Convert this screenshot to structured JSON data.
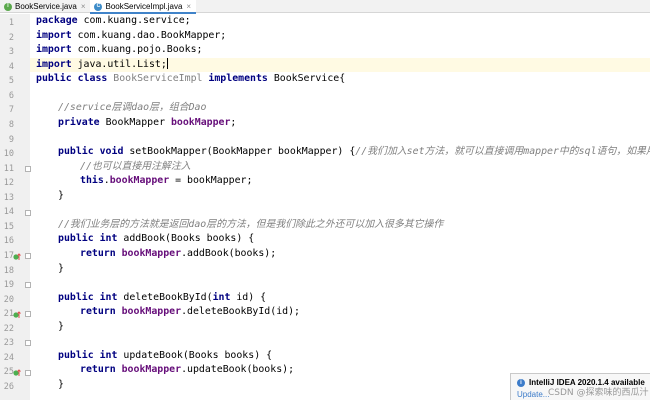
{
  "tabs": [
    {
      "label": "BookService.java",
      "kind": "interface",
      "icon": "interface-icon",
      "active": false
    },
    {
      "label": "BookServiceImpl.java",
      "kind": "class",
      "icon": "class-icon",
      "active": true
    }
  ],
  "close_glyph": "×",
  "line_numbers": [
    "1",
    "2",
    "3",
    "4",
    "5",
    "6",
    "7",
    "8",
    "9",
    "10",
    "11",
    "12",
    "13",
    "14",
    "15",
    "16",
    "17",
    "18",
    "19",
    "20",
    "21",
    "22",
    "23",
    "24",
    "25",
    "26"
  ],
  "code": {
    "l1": {
      "kw": "package",
      "rest": " com.kuang.service;"
    },
    "l2": {
      "kw": "import",
      "rest": " com.kuang.dao.BookMapper;"
    },
    "l3": {
      "kw": "import",
      "rest": " com.kuang.pojo.Books;"
    },
    "l4": {
      "kw": "import",
      "rest": " java.util.List;"
    },
    "l5": {
      "kw": "public class",
      "cls": " BookServiceImpl",
      "kw2": " implements",
      "rest": " BookService{"
    },
    "l7": {
      "comment": "//service层调dao层，组合Dao"
    },
    "l8": {
      "kw": "private",
      "type": " BookMapper ",
      "field": "bookMapper",
      "rest": ";"
    },
    "l10": {
      "kw": "public void",
      "rest": " setBookMapper(BookMapper bookMapper) {",
      "comment": "//我们加入set方法，就可以直接调用mapper中的sql语句，如果用注解的话"
    },
    "l11": {
      "comment": "//也可以直接用注解注入"
    },
    "l12": {
      "kw": "this",
      "dot": ".",
      "field": "bookMapper",
      "rest": " = bookMapper;"
    },
    "l13": {
      "rest": "}"
    },
    "l15": {
      "comment": "//我们业务层的方法就是返回dao层的方法，但是我们除此之外还可以加入很多其它操作"
    },
    "l16": {
      "kw": "public int",
      "rest": " addBook(Books books) {"
    },
    "l17": {
      "kw": "return",
      "field": " bookMapper",
      "rest": ".addBook(books);"
    },
    "l18": {
      "rest": "}"
    },
    "l20": {
      "kw": "public int",
      "rest": " deleteBookById(",
      "kw2": "int",
      "rest2": " id) {"
    },
    "l21": {
      "kw": "return",
      "field": " bookMapper",
      "rest": ".deleteBookById(id);"
    },
    "l22": {
      "rest": "}"
    },
    "l24": {
      "kw": "public int",
      "rest": " updateBook(Books books) {"
    },
    "l25": {
      "kw": "return",
      "field": " bookMapper",
      "rest": ".updateBook(books);"
    },
    "l26": {
      "rest": "}"
    }
  },
  "notification": {
    "title": "IntelliJ IDEA 2020.1.4 available",
    "link": "Update...",
    "icon": "info-icon"
  },
  "watermark": "CSDN @探索味的西瓜汁",
  "colors": {
    "keyword": "#000080",
    "field": "#660e7a",
    "comment": "#808080",
    "current_line": "#fffae3",
    "gutter": "#f0f0f0",
    "tab_accent": "#4083c9",
    "override_marker": "#4caf50"
  }
}
